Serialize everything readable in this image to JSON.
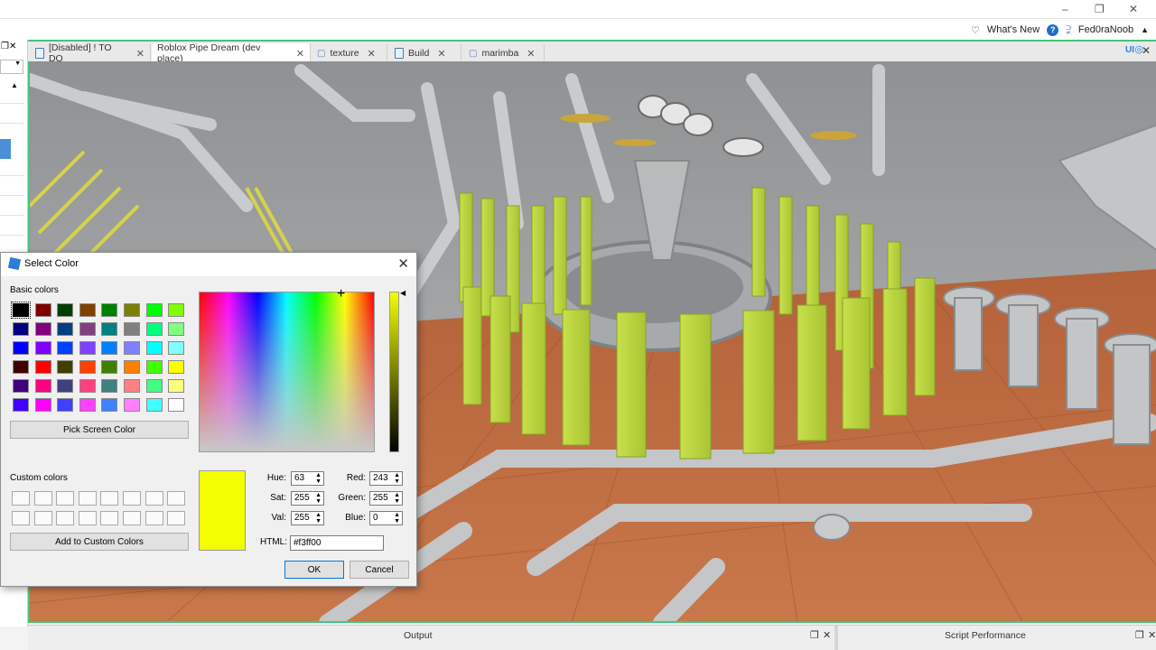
{
  "window": {
    "min": "–",
    "max": "❐",
    "close": "✕"
  },
  "menubar": {
    "whats_new": "What's New",
    "username": "Fed0raNoob"
  },
  "tabs": [
    {
      "label": "[Disabled] ! TO DO",
      "close": "✕"
    },
    {
      "label": "Roblox Pipe Dream (dev place)",
      "close": "✕"
    },
    {
      "label": "texture",
      "close": "✕"
    },
    {
      "label": "Build",
      "close": "✕"
    },
    {
      "label": "marimba",
      "close": "✕"
    }
  ],
  "ui_toggle": "UI",
  "bottom": {
    "output": "Output",
    "script_performance": "Script Performance"
  },
  "dialog": {
    "title": "Select Color",
    "basic_colors_label": "Basic colors",
    "basic_colors": [
      [
        "#000000",
        "#800000",
        "#004000",
        "#804000",
        "#008000",
        "#808000",
        "#00ff00",
        "#80ff00"
      ],
      [
        "#000080",
        "#800080",
        "#004080",
        "#804080",
        "#008080",
        "#808080",
        "#00ff80",
        "#80ff80"
      ],
      [
        "#0000ff",
        "#8000ff",
        "#0040ff",
        "#8040ff",
        "#0080ff",
        "#8080ff",
        "#00ffff",
        "#80ffff"
      ],
      [
        "#400000",
        "#ff0000",
        "#404000",
        "#ff4000",
        "#408000",
        "#ff8000",
        "#40ff00",
        "#ffff00"
      ],
      [
        "#400080",
        "#ff0080",
        "#404080",
        "#ff4080",
        "#408080",
        "#ff8080",
        "#40ff80",
        "#ffff80"
      ],
      [
        "#4000ff",
        "#ff00ff",
        "#4040ff",
        "#ff40ff",
        "#4080ff",
        "#ff80ff",
        "#40ffff",
        "#ffffff"
      ]
    ],
    "pick_screen_color": "Pick Screen Color",
    "custom_colors_label": "Custom colors",
    "add_to_custom": "Add to Custom Colors",
    "current_color": "#f3ff00",
    "fields": {
      "hue_label": "Hue:",
      "hue": "63",
      "sat_label": "Sat:",
      "sat": "255",
      "val_label": "Val:",
      "val": "255",
      "red_label": "Red:",
      "red": "243",
      "green_label": "Green:",
      "green": "255",
      "blue_label": "Blue:",
      "blue": "0"
    },
    "html_label": "HTML:",
    "html_value": "#f3ff00",
    "ok": "OK",
    "cancel": "Cancel"
  }
}
